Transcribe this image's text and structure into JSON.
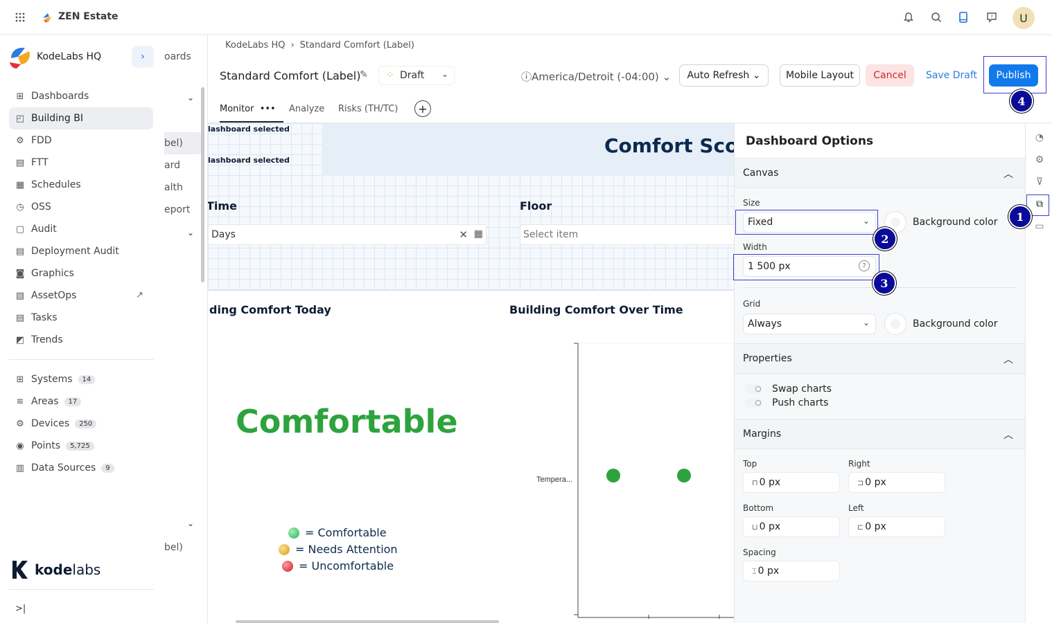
{
  "app": {
    "name": "ZEN Estate",
    "avatar_initial": "U"
  },
  "topbar_icons": [
    "bell-icon",
    "search-icon",
    "tablet-icon",
    "help-icon"
  ],
  "sidebar": {
    "org_name": "KodeLabs HQ",
    "items": [
      {
        "label": "Dashboards",
        "icon": "dashboards-icon"
      },
      {
        "label": "Building BI",
        "icon": "building-bi-icon",
        "active": true
      },
      {
        "label": "FDD",
        "icon": "fdd-icon"
      },
      {
        "label": "FTT",
        "icon": "ftt-icon"
      },
      {
        "label": "Schedules",
        "icon": "schedules-icon"
      },
      {
        "label": "OSS",
        "icon": "oss-icon"
      },
      {
        "label": "Audit",
        "icon": "audit-icon"
      },
      {
        "label": "Deployment Audit",
        "icon": "deployment-audit-icon"
      },
      {
        "label": "Graphics",
        "icon": "graphics-icon"
      },
      {
        "label": "AssetOps",
        "icon": "assetops-icon"
      },
      {
        "label": "Tasks",
        "icon": "tasks-icon"
      },
      {
        "label": "Trends",
        "icon": "trends-icon"
      }
    ],
    "resources": [
      {
        "label": "Systems",
        "count": "14"
      },
      {
        "label": "Areas",
        "count": "17"
      },
      {
        "label": "Devices",
        "count": "250"
      },
      {
        "label": "Points",
        "count": "5,725"
      },
      {
        "label": "Data Sources",
        "count": "9"
      }
    ],
    "logo_a": "kode",
    "logo_b": "labs"
  },
  "subpanel": {
    "texts": [
      "oards",
      "bel)",
      "ard",
      "alth",
      "eport",
      "bel)"
    ]
  },
  "breadcrumb": {
    "root": "KodeLabs HQ",
    "current": "Standard Comfort (Label)"
  },
  "header": {
    "title": "Standard Comfort (Label)",
    "status": "Draft",
    "timezone": "America/Detroit (-04:00)",
    "auto_refresh": "Auto Refresh",
    "mobile_layout": "Mobile Layout",
    "cancel": "Cancel",
    "save_draft": "Save Draft",
    "publish": "Publish"
  },
  "tabs": [
    {
      "label": "Monitor",
      "active": true
    },
    {
      "label": "Analyze"
    },
    {
      "label": "Risks (TH/TC)"
    }
  ],
  "canvas": {
    "hint_1": "lashboard selected",
    "hint_2": "lashboard selected",
    "score_title": "Comfort Score",
    "filter_time_label": "Time",
    "filter_time_value": "Days",
    "filter_floor_label": "Floor",
    "filter_floor_placeholder": "Select item",
    "widget_today_title": "ding Comfort Today",
    "widget_overtime_title": "Building Comfort Over Time",
    "comfort_status": "Comfortable",
    "legend": [
      {
        "label": "= Comfortable",
        "color": "#3fbf68"
      },
      {
        "label": "= Needs Attention",
        "color": "#e9b531"
      },
      {
        "label": "= Uncomfortable",
        "color": "#e0323c"
      }
    ],
    "chart_ylabel": "Tempera..."
  },
  "chart_data": {
    "type": "scatter",
    "series": [
      {
        "y_category": "Tempera...",
        "points": [
          1,
          2
        ],
        "color": "#2ea33d"
      }
    ]
  },
  "options": {
    "title": "Dashboard Options",
    "canvas_section": "Canvas",
    "size_label": "Size",
    "size_value": "Fixed",
    "bg_color_label": "Background color",
    "width_label": "Width",
    "width_value": "1 500 px",
    "grid_label": "Grid",
    "grid_value": "Always",
    "grid_bg_label": "Background color",
    "properties_section": "Properties",
    "swap_charts": "Swap charts",
    "push_charts": "Push charts",
    "margins_section": "Margins",
    "top_label": "Top",
    "top_value": "0 px",
    "right_label": "Right",
    "right_value": "0 px",
    "bottom_label": "Bottom",
    "bottom_value": "0 px",
    "left_label": "Left",
    "left_value": "0 px",
    "spacing_label": "Spacing",
    "spacing_value": "0 px"
  },
  "markers": [
    "1",
    "2",
    "3",
    "4"
  ]
}
